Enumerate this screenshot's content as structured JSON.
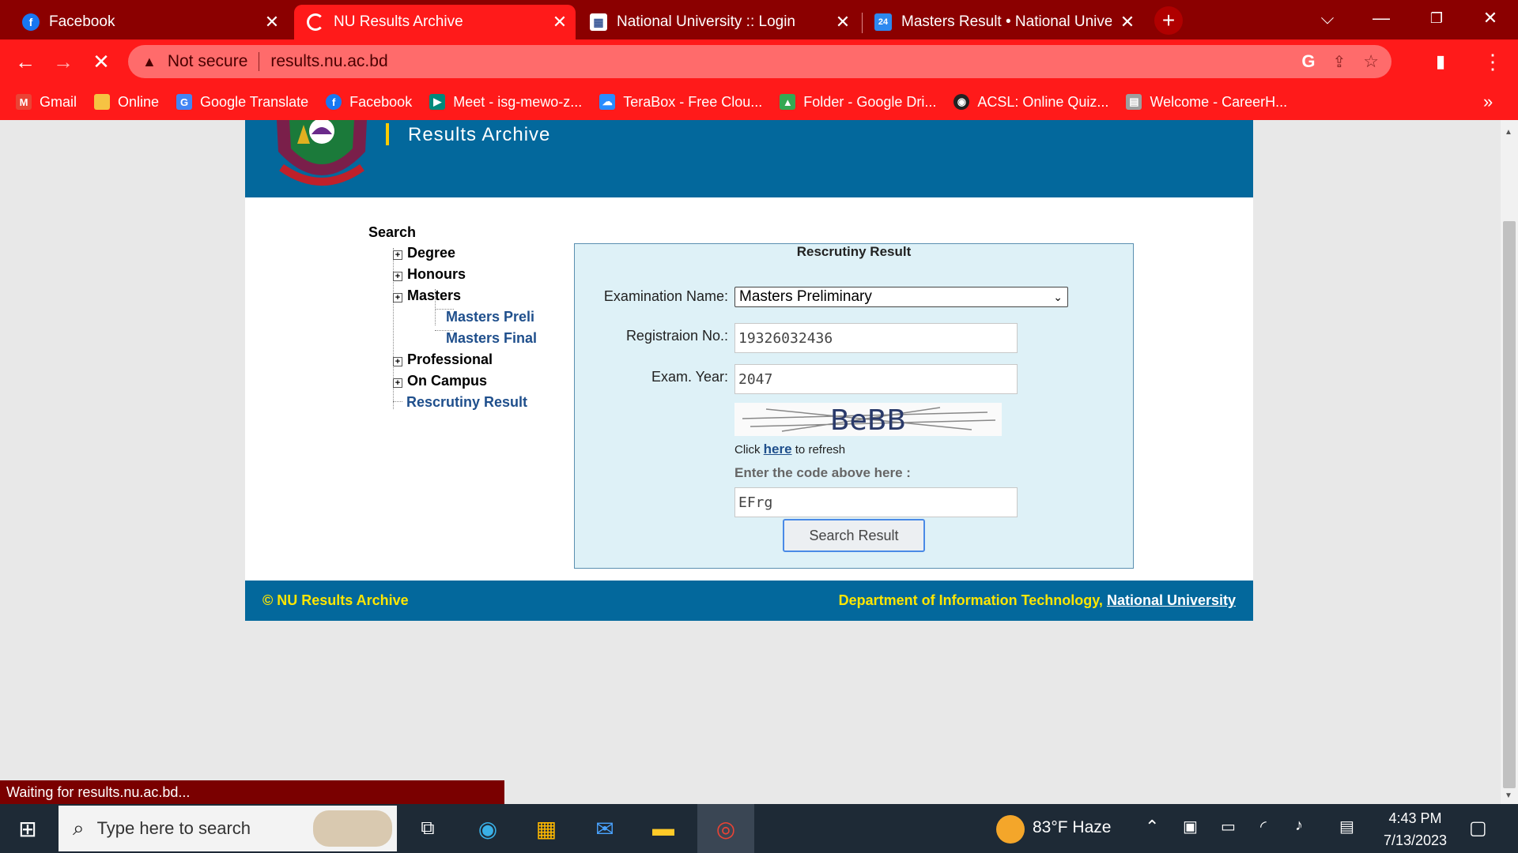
{
  "browser": {
    "tabs": [
      {
        "title": "Facebook",
        "favicon": "facebook-icon",
        "color": "#1877f2"
      },
      {
        "title": "NU Results Archive",
        "favicon": "loading-spinner-icon",
        "color": "#ffffff",
        "active": true
      },
      {
        "title": "National University :: Login",
        "favicon": "nu-login-icon",
        "color": "#3b5998"
      },
      {
        "title": "Masters Result • National Univers",
        "favicon": "masters-result-icon",
        "color": "#2d89ef"
      }
    ],
    "new_tab": "+",
    "security_label": "Not secure",
    "url": "results.nu.ac.bd",
    "bookmarks": [
      {
        "label": "Gmail",
        "icon": "gmail-icon",
        "color": "#ea4335"
      },
      {
        "label": "Online",
        "icon": "folder-yellow-icon",
        "color": "#f6c343"
      },
      {
        "label": "Google Translate",
        "icon": "google-translate-icon",
        "color": "#4285f4"
      },
      {
        "label": "Facebook",
        "icon": "facebook-icon",
        "color": "#1877f2"
      },
      {
        "label": "Meet - isg-mewo-z...",
        "icon": "google-meet-icon",
        "color": "#00897b"
      },
      {
        "label": "TeraBox - Free Clou...",
        "icon": "terabox-icon",
        "color": "#2a8cff"
      },
      {
        "label": "Folder - Google Dri...",
        "icon": "google-drive-icon",
        "color": "#34a853"
      },
      {
        "label": "ACSL: Online Quiz...",
        "icon": "acsl-icon",
        "color": "#222222"
      },
      {
        "label": "Welcome - CareerH...",
        "icon": "careerh-icon",
        "color": "#9e9e9e"
      }
    ],
    "more_bookmarks": "»"
  },
  "page": {
    "header_title": "Results Archive",
    "tree_title": "Search",
    "tree": [
      {
        "label": "Degree",
        "expandable": true
      },
      {
        "label": "Honours",
        "expandable": true
      },
      {
        "label": "Masters",
        "expandable": true
      },
      {
        "label": "Masters Preli",
        "child": true
      },
      {
        "label": "Masters Final",
        "child": true
      },
      {
        "label": "Professional",
        "expandable": true
      },
      {
        "label": "On Campus",
        "expandable": true
      },
      {
        "label": "Rescrutiny Result",
        "link": true
      }
    ],
    "form": {
      "title": "Rescrutiny Result",
      "exam_label": "Examination Name:",
      "exam_value": "Masters Preliminary",
      "reg_label": "Registraion No.:",
      "reg_value": "19326032436",
      "year_label": "Exam. Year:",
      "year_value": "2047",
      "captcha_text": "BeBB",
      "refresh_prefix": "Click",
      "refresh_link": "here",
      "refresh_suffix": "to refresh",
      "code_label": "Enter the code above here :",
      "code_value": "EFrg",
      "submit_label": "Search Result"
    },
    "footer_left": "© NU Results Archive",
    "footer_right_prefix": "Department of Information Technology,",
    "footer_right_link": "National University"
  },
  "status_text": "Waiting for results.nu.ac.bd...",
  "taskbar": {
    "search_placeholder": "Type here to search",
    "weather": "83°F  Haze",
    "time": "4:43 PM",
    "date": "7/13/2023"
  }
}
